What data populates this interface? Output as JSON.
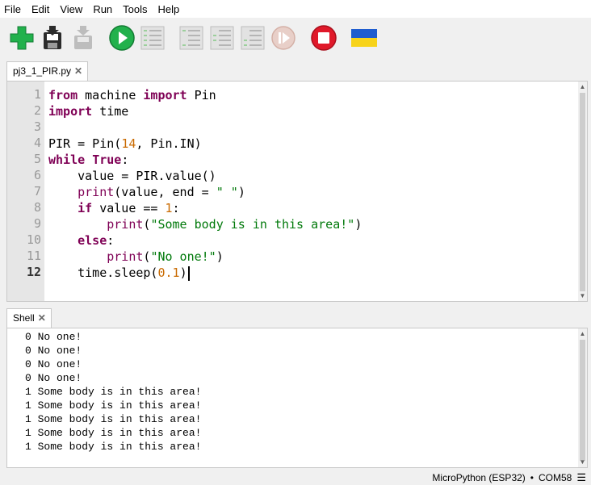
{
  "menu": [
    "File",
    "Edit",
    "View",
    "Run",
    "Tools",
    "Help"
  ],
  "editor_tab": {
    "label": "pj3_1_PIR.py",
    "close": "✕"
  },
  "editor": {
    "line_numbers": [
      "1",
      "2",
      "3",
      "4",
      "5",
      "6",
      "7",
      "8",
      "9",
      "10",
      "11",
      "12"
    ],
    "current_line": "12",
    "lines": [
      "from machine import Pin",
      "import time",
      "",
      "PIR = Pin(14, Pin.IN)",
      "while True:",
      "    value = PIR.value()",
      "    print(value, end = \" \")",
      "    if value == 1:",
      "        print(\"Some body is in this area!\")",
      "    else:",
      "        print(\"No one!\")",
      "    time.sleep(0.1)"
    ]
  },
  "shell_tab": {
    "label": "Shell",
    "close": "✕"
  },
  "shell": {
    "lines": [
      "0 No one!",
      "0 No one!",
      "0 No one!",
      "0 No one!",
      "1 Some body is in this area!",
      "1 Some body is in this area!",
      "1 Some body is in this area!",
      "1 Some body is in this area!",
      "1 Some body is in this area!"
    ]
  },
  "status": {
    "interpreter": "MicroPython (ESP32)",
    "separator": "•",
    "port": "COM58"
  },
  "colors": {
    "keyword": "#7f0055",
    "number": "#c96a00",
    "string": "#00790a",
    "run_green": "#22b14c",
    "stop_red": "#e0192a"
  },
  "toolbar_icons": [
    "new-file-icon",
    "save-icon",
    "download-icon",
    "run-icon",
    "debug-icon",
    "step-over-icon",
    "step-into-icon",
    "step-out-icon",
    "resume-icon",
    "stop-icon",
    "ukraine-flag-icon"
  ]
}
